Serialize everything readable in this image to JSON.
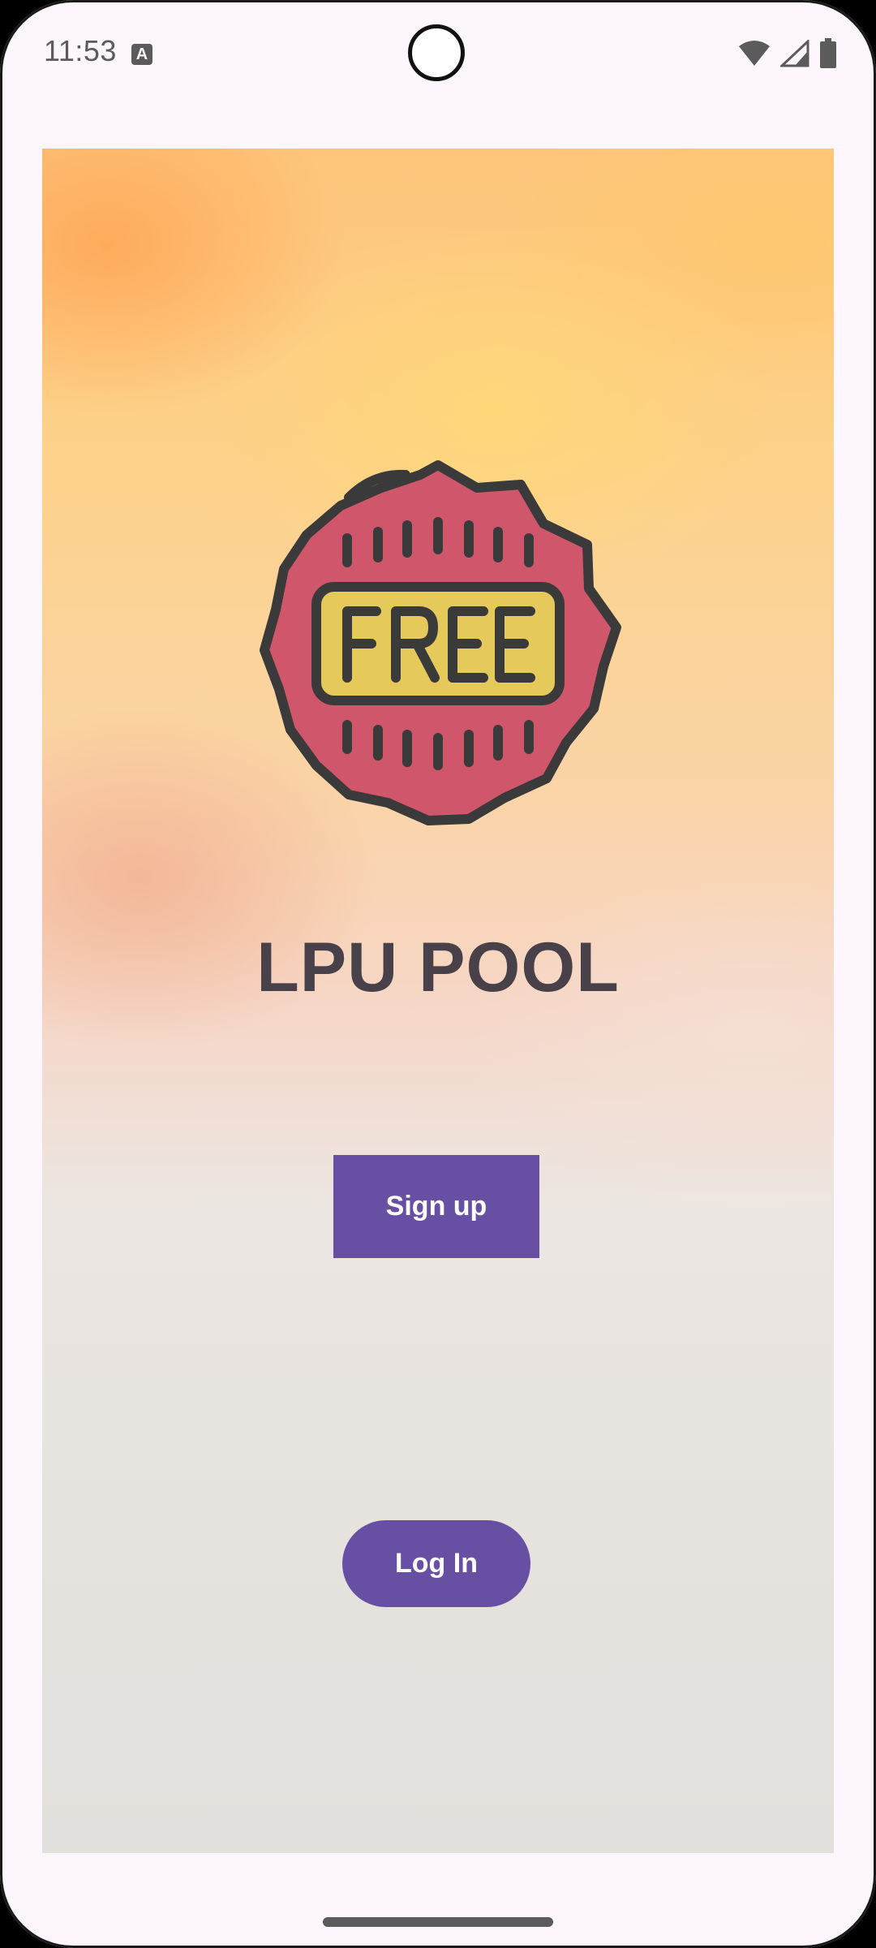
{
  "status_bar": {
    "time": "11:53",
    "keyboard_badge": "A",
    "icons": [
      "wifi-icon",
      "signal-icon",
      "battery-icon"
    ]
  },
  "main": {
    "badge": {
      "icon": "free-badge-icon",
      "text": "FREE",
      "colors": {
        "outer": "#d0566b",
        "inner": "#e5c95a",
        "stroke": "#3a3a3a"
      }
    },
    "title": "LPU POOL",
    "signup_label": "Sign up",
    "login_label": "Log In"
  },
  "colors": {
    "accent": "#6750a4",
    "background": "#fdf6fc",
    "title": "#48414a"
  },
  "nav": {
    "handle": "home-gesture-handle"
  }
}
